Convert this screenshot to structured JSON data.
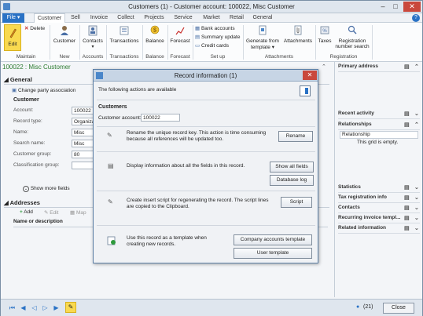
{
  "window": {
    "title": "Customers (1) - Customer account: 100022, Misc Customer"
  },
  "ribbon_tabs": [
    {
      "label": "File"
    },
    {
      "label": "Customer"
    },
    {
      "label": "Sell"
    },
    {
      "label": "Invoice"
    },
    {
      "label": "Collect"
    },
    {
      "label": "Projects"
    },
    {
      "label": "Service"
    },
    {
      "label": "Market"
    },
    {
      "label": "Retail"
    },
    {
      "label": "General"
    }
  ],
  "ribbon": {
    "maintain": {
      "edit": "Edit",
      "delete": "Delete",
      "group": "Maintain"
    },
    "new": {
      "customer": "Customer",
      "group": "New"
    },
    "accounts": {
      "contacts": "Contacts",
      "group": "Accounts"
    },
    "transactions": {
      "transactions": "Transactions",
      "group": "Transactions"
    },
    "balance": {
      "balance": "Balance",
      "group": "Balance"
    },
    "forecast": {
      "forecast": "Forecast",
      "group": "Forecast"
    },
    "setup": {
      "bank_accounts": "Bank accounts",
      "summary_update": "Summary update",
      "credit_cards": "Credit cards",
      "group": "Set up"
    },
    "attachments": {
      "generate": "Generate from",
      "template": "template",
      "attachments": "Attachments",
      "group": "Attachments"
    },
    "registration": {
      "taxes": "Taxes",
      "reg_number": "Registration",
      "reg_search": "number search",
      "group": "Registration"
    }
  },
  "header": {
    "breadcrumb": "100022 : Misc Customer"
  },
  "general": {
    "title": "General",
    "change_party": "Change party association",
    "customer_section": "Customer",
    "fields": [
      {
        "label": "Account:",
        "value": "100022"
      },
      {
        "label": "Record type:",
        "value": "Organization"
      },
      {
        "label": "Name:",
        "value": "Misc Customer"
      },
      {
        "label": "Search name:",
        "value": "Misc Customer"
      },
      {
        "label": "Customer group:",
        "value": "80"
      },
      {
        "label": "Classification group:",
        "value": ""
      }
    ],
    "show_more": "Show more fields"
  },
  "addresses": {
    "title": "Addresses",
    "toolbar": {
      "add": "Add",
      "edit": "Edit",
      "map": "Map"
    },
    "column": "Name or description"
  },
  "right_pane": {
    "primary_address": "Primary address",
    "recent_activity": "Recent activity",
    "relationships": "Relationships",
    "relationship_col": "Relationship",
    "empty_grid": "This grid is empty.",
    "statistics": "Statistics",
    "tax_registration": "Tax registration info",
    "contacts": "Contacts",
    "recurring_invoice": "Recurring invoice templ...",
    "related_info": "Related information"
  },
  "modal": {
    "title": "Record information (1)",
    "intro": "The following actions are available",
    "section": "Customers",
    "account_label": "Customer account:",
    "account_value": "100022",
    "rows": [
      {
        "text": "Rename the unique record key. This action is time consuming because all references will be updated too.",
        "buttons": [
          "Rename"
        ]
      },
      {
        "text": "Display information about all the fields in this record.",
        "buttons": [
          "Show all fields",
          "Database log"
        ]
      },
      {
        "text": "Create insert script for regenerating the record. The script lines are copied to the Clipboard.",
        "buttons": [
          "Script"
        ]
      },
      {
        "text": "Use this record as a template when creating new records.",
        "buttons": [
          "Company accounts template",
          "User template"
        ]
      }
    ]
  },
  "footer": {
    "count": "(21)",
    "close": "Close"
  }
}
